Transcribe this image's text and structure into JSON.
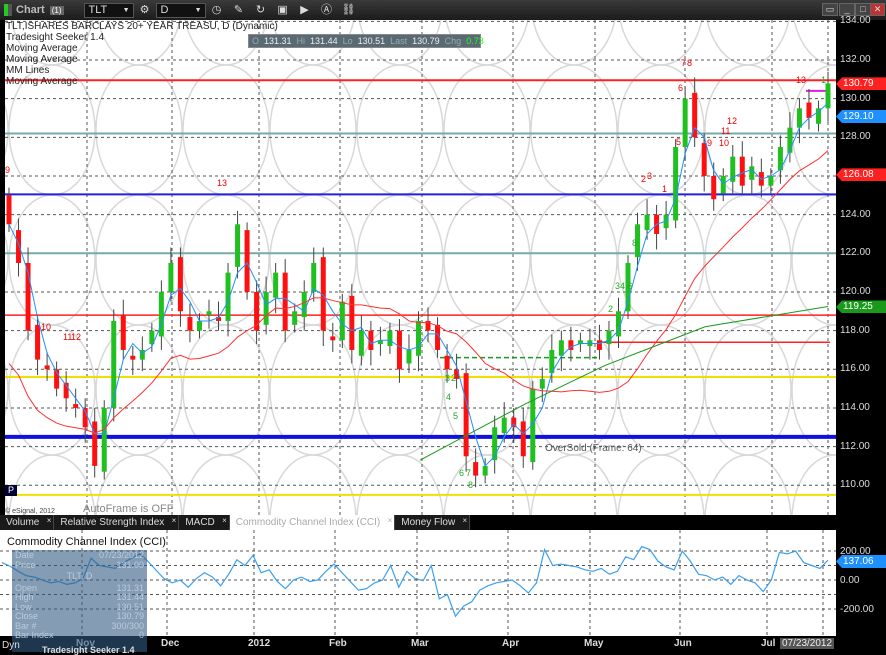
{
  "window": {
    "title": "Chart",
    "link_badge": "(1)",
    "symbol": "TLT",
    "interval": "D",
    "icons": [
      "settings-icon",
      "clock-icon",
      "pencil-icon",
      "refresh-icon",
      "snapshot-icon",
      "play-icon",
      "alert-icon",
      "link-icon"
    ]
  },
  "legend": [
    "TLT,ISHARES BARCLAYS 20+ YEAR TREASU, D (Dynamic)",
    "Tradesight Seeker 1.4",
    "Moving Average",
    "Moving Average",
    "MM Lines",
    "Moving Average"
  ],
  "quote": {
    "o_label": "O",
    "o": "131.31",
    "hi_label": "Hi",
    "hi": "131.44",
    "lo_label": "Lo",
    "lo": "130.51",
    "last_label": "Last",
    "last": "130.79",
    "chg_label": "Chg",
    "chg": "0.73"
  },
  "price_axis": {
    "labels": [
      "134.00",
      "132.00",
      "130.00",
      "128.00",
      "126.00",
      "124.00",
      "122.00",
      "120.00",
      "118.00",
      "116.00",
      "114.00",
      "112.00",
      "110.00"
    ],
    "tags": [
      {
        "text": "130.79",
        "color": "#ff2020",
        "value": 130.79
      },
      {
        "text": "129.10",
        "color": "#1e90ff",
        "value": 129.1
      },
      {
        "text": "126.08",
        "color": "#ff2020",
        "value": 126.08
      },
      {
        "text": "119.25",
        "color": "#1a9a1a",
        "value": 119.25
      }
    ]
  },
  "annotations": {
    "oversold": "OverSold (Frame: 64)",
    "autoframe": "AutoFrame is OFF",
    "copyright": "© eSignal, 2012",
    "p_marker": "P",
    "counts": [
      {
        "t": "9",
        "c": "r"
      },
      {
        "t": "13",
        "c": "r"
      },
      {
        "t": "10",
        "c": "r"
      },
      {
        "t": "11",
        "c": "r"
      },
      {
        "t": "12",
        "c": "r"
      },
      {
        "t": "7",
        "c": "r"
      },
      {
        "t": "8",
        "c": "r"
      },
      {
        "t": "6",
        "c": "r"
      },
      {
        "t": "5",
        "c": "r"
      },
      {
        "t": "9",
        "c": "r"
      },
      {
        "t": "10",
        "c": "r"
      },
      {
        "t": "11",
        "c": "r"
      },
      {
        "t": "12",
        "c": "r"
      },
      {
        "t": "13",
        "c": "r"
      },
      {
        "t": "1",
        "c": "g"
      },
      {
        "t": "2",
        "c": "r"
      },
      {
        "t": "3",
        "c": "r"
      },
      {
        "t": "1",
        "c": "r"
      },
      {
        "t": "8",
        "c": "g"
      },
      {
        "t": "34.6",
        "c": "g"
      },
      {
        "t": "2",
        "c": "g"
      },
      {
        "t": "1",
        "c": "g"
      },
      {
        "t": "3",
        "c": "g"
      },
      {
        "t": "2",
        "c": "g"
      },
      {
        "t": "4",
        "c": "g"
      },
      {
        "t": "5",
        "c": "g"
      },
      {
        "t": "6",
        "c": "g"
      },
      {
        "t": "7",
        "c": "g"
      },
      {
        "t": "8",
        "c": "g"
      }
    ]
  },
  "tabs": [
    {
      "label": "Volume"
    },
    {
      "label": "Relative Strength Index"
    },
    {
      "label": "MACD"
    },
    {
      "label": "Commodity Channel Index (CCI)",
      "active": true
    },
    {
      "label": "Money Flow"
    }
  ],
  "cci": {
    "title": "Commodity Channel Index (CCI)",
    "axis": [
      "200.00",
      "0.00",
      "-200.00"
    ],
    "current": "137.06"
  },
  "date_axis": [
    "Nov",
    "Dec",
    "2012",
    "Feb",
    "Mar",
    "Apr",
    "May",
    "Jun",
    "Jul"
  ],
  "current_date": "07/23/2012",
  "data_window": {
    "rows": [
      [
        "Date",
        "07/23/2012"
      ],
      [
        "Price",
        "131.00"
      ]
    ],
    "symbol": "TLT, D",
    "rows2": [
      [
        "Open",
        "131.31"
      ],
      [
        "High",
        "131.44"
      ],
      [
        "Low",
        "130.51"
      ],
      [
        "Close",
        "130.79"
      ],
      [
        "Bar #",
        "300/300"
      ],
      [
        "Bar Index",
        "0"
      ]
    ],
    "footer": "Tradesight Seeker 1.4",
    "dyn": "Dyn"
  },
  "chart_data": {
    "type": "candlestick",
    "symbol": "TLT",
    "closes": [
      123.5,
      121.5,
      118,
      116.5,
      116,
      115,
      114.5,
      114,
      113,
      111,
      114,
      118.5,
      117,
      116.5,
      117,
      118,
      120,
      121.5,
      119,
      118,
      118.5,
      119,
      118.5,
      121,
      123.5,
      120,
      118,
      120,
      121,
      118,
      119,
      120,
      121.5,
      118,
      117.5,
      119.5,
      117,
      118,
      117,
      117.5,
      118,
      116,
      117,
      118.5,
      118,
      117,
      116,
      115.5,
      111.5,
      110.5,
      111,
      113,
      113.5,
      113,
      111.5,
      115,
      115.5,
      117,
      117.5,
      117,
      117.5,
      117.5,
      117,
      118,
      119,
      121.5,
      123.5,
      124,
      123,
      124,
      127.5,
      130,
      128,
      126,
      124.8,
      126,
      127,
      125.5,
      126.5,
      125.5,
      126,
      127.5,
      128.5,
      129.5,
      129,
      129.5,
      130.79
    ],
    "cci": [
      120,
      95,
      60,
      30,
      20,
      0,
      -20,
      -10,
      -30,
      -20,
      10,
      150,
      100,
      90,
      80,
      120,
      150,
      180,
      130,
      70,
      10,
      -20,
      0,
      -50,
      10,
      50,
      20,
      -40,
      40,
      140,
      100,
      170,
      50,
      70,
      -10,
      -60,
      0,
      20,
      -10,
      0,
      60,
      110,
      50,
      -10,
      -70,
      -60,
      -20,
      0,
      100,
      -50,
      60,
      10,
      -5,
      100,
      -130,
      -100,
      -250,
      -180,
      -150,
      -70,
      -40,
      -20,
      -10,
      0,
      -40,
      -90,
      -20,
      210,
      100,
      110,
      100,
      90,
      70,
      60,
      80,
      40,
      60,
      160,
      140,
      230,
      210,
      130,
      90,
      70,
      200,
      130,
      40,
      30,
      0,
      20,
      -30,
      30,
      0,
      -20,
      -80,
      0,
      190,
      180,
      200,
      120,
      100,
      80,
      137
    ]
  }
}
